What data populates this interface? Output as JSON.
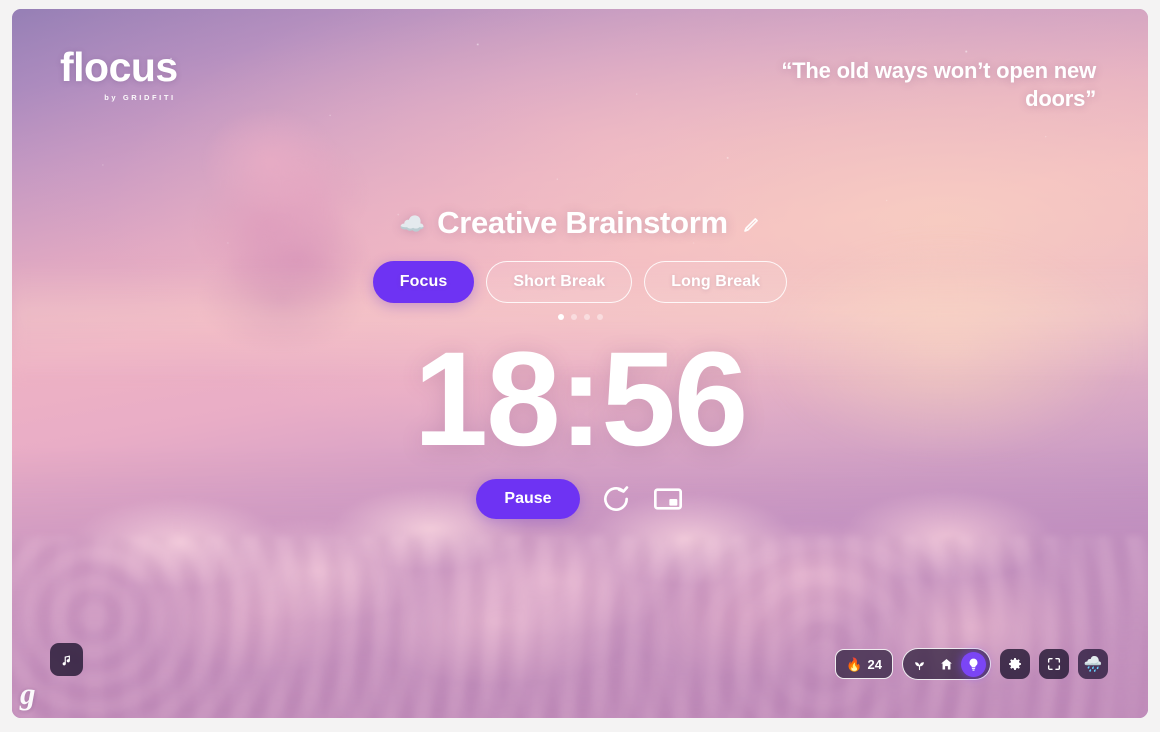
{
  "brand": {
    "name": "flocus",
    "tagline": "by GRIDFITI"
  },
  "quote": {
    "text": "“The old ways won’t open new doors”"
  },
  "task": {
    "emoji": "☁️",
    "title": "Creative Brainstorm",
    "edit_icon": "pencil-icon"
  },
  "tabs": [
    {
      "label": "Focus",
      "active": true
    },
    {
      "label": "Short Break",
      "active": false
    },
    {
      "label": "Long Break",
      "active": false
    }
  ],
  "session_dots": {
    "total": 4,
    "current": 1
  },
  "timer": {
    "display": "18:56",
    "minutes": "18",
    "seconds": "56"
  },
  "controls": {
    "primary_label": "Pause",
    "reset_icon": "reset-icon",
    "pip_icon": "picture-in-picture-icon"
  },
  "bottom_left": {
    "music_icon": "music-note-icon",
    "watermark": "g"
  },
  "toolbar": {
    "streak": {
      "emoji": "🔥",
      "count": "24"
    },
    "modes": [
      {
        "name": "plant",
        "icon": "sprout-icon",
        "active": false
      },
      {
        "name": "home",
        "icon": "home-icon",
        "active": false
      },
      {
        "name": "focus-light",
        "icon": "lightbulb-icon",
        "active": true
      }
    ],
    "buttons": [
      {
        "name": "settings",
        "icon": "gear-icon"
      },
      {
        "name": "fullscreen",
        "icon": "fullscreen-icon"
      },
      {
        "name": "sounds",
        "icon": "rain-cloud-icon",
        "emoji": "🌧️"
      }
    ]
  },
  "colors": {
    "accent": "#6e33f3",
    "accent_light": "#7b45f5",
    "text_on_image": "#ffffff"
  }
}
